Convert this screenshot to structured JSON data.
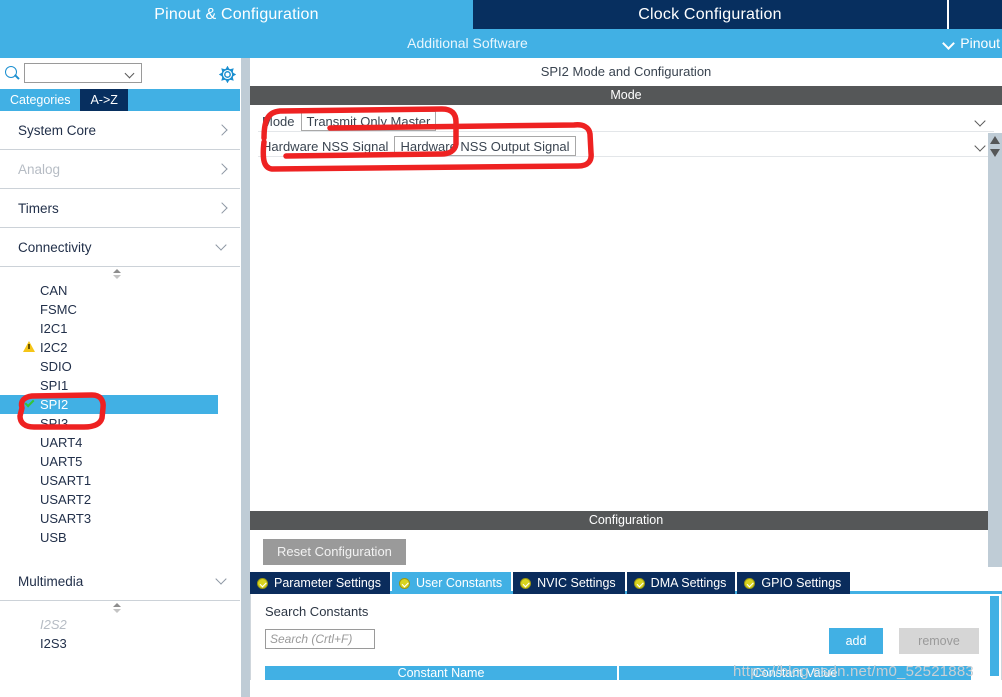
{
  "top_tabs": [
    {
      "label": "Pinout & Configuration",
      "active": true
    },
    {
      "label": "Clock Configuration",
      "active": false
    },
    {
      "label": "",
      "active": false
    }
  ],
  "subbar": {
    "additional_software": "Additional Software",
    "pinout_menu": "Pinout",
    "chevron_icon": "chevron-down-icon"
  },
  "sidebar": {
    "search": {
      "value": "",
      "placeholder": ""
    },
    "search_icon": "search-icon",
    "gear_icon": "gear-icon",
    "tabs": [
      {
        "label": "Categories",
        "active": true
      },
      {
        "label": "A->Z",
        "active": false
      }
    ],
    "categories": [
      {
        "label": "System Core",
        "expanded": false,
        "disabled": false,
        "chevron": "chevron-right-icon"
      },
      {
        "label": "Analog",
        "expanded": false,
        "disabled": true,
        "chevron": "chevron-right-icon"
      },
      {
        "label": "Timers",
        "expanded": false,
        "disabled": false,
        "chevron": "chevron-right-icon"
      },
      {
        "label": "Connectivity",
        "expanded": true,
        "disabled": false,
        "chevron": "chevron-down-icon"
      }
    ],
    "connectivity_items": [
      {
        "label": "CAN",
        "state": "normal",
        "mark": ""
      },
      {
        "label": "FSMC",
        "state": "normal",
        "mark": ""
      },
      {
        "label": "I2C1",
        "state": "normal",
        "mark": ""
      },
      {
        "label": "I2C2",
        "state": "normal",
        "mark": "warning-triangle-icon"
      },
      {
        "label": "SDIO",
        "state": "normal",
        "mark": ""
      },
      {
        "label": "SPI1",
        "state": "normal",
        "mark": ""
      },
      {
        "label": "SPI2",
        "state": "selected",
        "mark": "check-icon"
      },
      {
        "label": "SPI3",
        "state": "normal",
        "mark": ""
      },
      {
        "label": "UART4",
        "state": "normal",
        "mark": ""
      },
      {
        "label": "UART5",
        "state": "normal",
        "mark": ""
      },
      {
        "label": "USART1",
        "state": "normal",
        "mark": ""
      },
      {
        "label": "USART2",
        "state": "normal",
        "mark": ""
      },
      {
        "label": "USART3",
        "state": "normal",
        "mark": ""
      },
      {
        "label": "USB",
        "state": "normal",
        "mark": ""
      }
    ],
    "multimedia": {
      "label": "Multimedia",
      "expanded": true,
      "chevron": "chevron-down-icon"
    },
    "multimedia_items": [
      {
        "label": "I2S2",
        "state": "dim"
      },
      {
        "label": "I2S3",
        "state": "normal"
      }
    ]
  },
  "main": {
    "peripheral_title": "SPI2 Mode and Configuration",
    "mode_header": "Mode",
    "fields": [
      {
        "label": "Mode",
        "value": "Transmit Only Master",
        "arrow": "chevron-down-icon"
      },
      {
        "label": "Hardware NSS Signal",
        "value": "Hardware NSS Output Signal",
        "arrow": "chevron-down-icon"
      }
    ],
    "configuration_header": "Configuration",
    "reset_button": "Reset Configuration",
    "config_tabs": [
      {
        "label": "Parameter Settings",
        "active": false,
        "icon": "status-check-icon"
      },
      {
        "label": "User Constants",
        "active": true,
        "icon": "status-check-icon"
      },
      {
        "label": "NVIC Settings",
        "active": false,
        "icon": "status-check-icon"
      },
      {
        "label": "DMA Settings",
        "active": false,
        "icon": "status-check-icon"
      },
      {
        "label": "GPIO Settings",
        "active": false,
        "icon": "status-check-icon"
      }
    ],
    "user_constants": {
      "search_label": "Search Constants",
      "search_value": "",
      "search_placeholder": "Search (Crtl+F)",
      "add_button": "add",
      "remove_button": "remove",
      "table_headers": [
        "Constant Name",
        "Constant Value"
      ]
    }
  },
  "watermark": "https://blog.csdn.net/m0_52521883",
  "colors": {
    "accent_blue": "#41b0e4",
    "navy": "#072f5f",
    "header_gray": "#555758",
    "annotation_red": "#ee2222",
    "warning_yellow": "#f5c518",
    "check_green": "#35c435"
  }
}
